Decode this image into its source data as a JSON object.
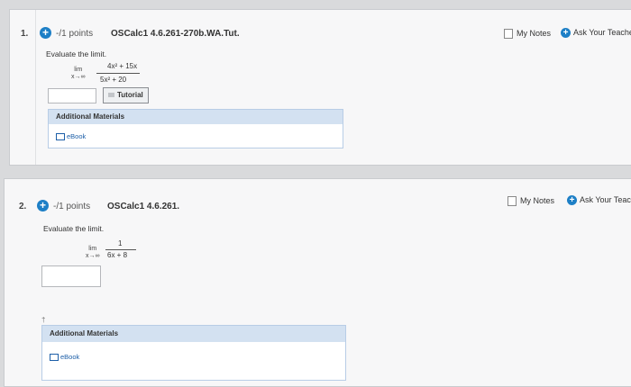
{
  "q1": {
    "number": "1.",
    "points": "-/1 points",
    "qid": "OSCalc1 4.6.261-270b.WA.Tut.",
    "my_notes": "My Notes",
    "ask": "Ask Your Teache",
    "prompt": "Evaluate the limit.",
    "lim": "lim",
    "lim_sub": "x→∞",
    "numerator": "4x² + 15x",
    "denominator": "5x² + 20",
    "tutorial": "Tutorial",
    "additional_materials": "Additional Materials",
    "ebook": "eBook"
  },
  "q2": {
    "number": "2.",
    "points": "-/1 points",
    "qid": "OSCalc1 4.6.261.",
    "my_notes": "My Notes",
    "ask": "Ask Your Teach",
    "prompt": "Evaluate the limit.",
    "lim": "lim",
    "lim_sub": "x→∞",
    "numerator": "1",
    "denominator": "6x + 8",
    "mark": "†",
    "additional_materials": "Additional Materials",
    "ebook": "eBook"
  },
  "colors": {
    "accent": "#1d7fc6",
    "header_blue": "#d3e1f1",
    "link": "#1d5fa8"
  }
}
